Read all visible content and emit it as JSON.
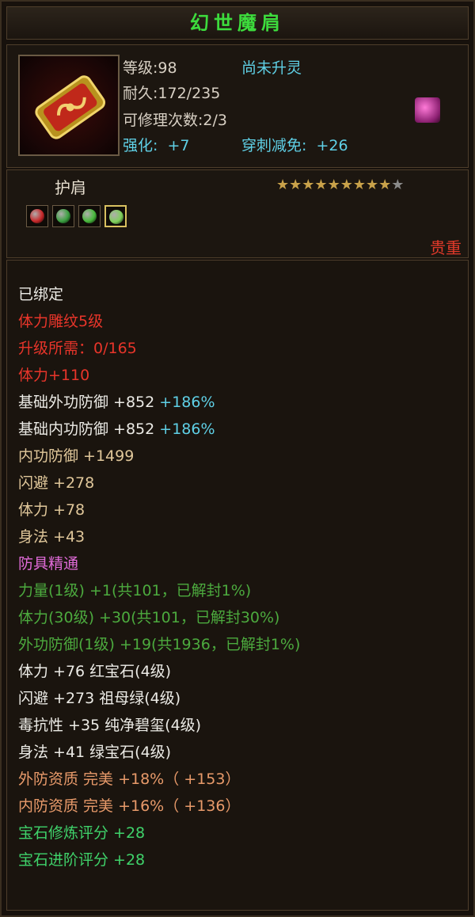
{
  "title": "幻世魔肩",
  "item": {
    "level_text": "等级:98",
    "spirit_status": "尚未升灵",
    "durability_text": "耐久:172/235",
    "repair_text": "可修理次数:2/3",
    "enhance_label": "强化:",
    "enhance_value": "+7",
    "pierce_label": "穿刺减免:",
    "pierce_value": "+26",
    "slot_type": "护肩",
    "stars_filled": 9,
    "stars_total": 10,
    "quality": "贵重",
    "gem_colors": [
      "#c8282a",
      "#3aa040",
      "#48b83c",
      "#7ed05a"
    ]
  },
  "colors": {
    "title": "#3ddc3d",
    "cyan": "#5fd0e6",
    "red": "#e8352a",
    "green": "#4caa3e",
    "bright_green": "#3fd26a",
    "orange": "#e89a6a",
    "pink": "#e06bd8",
    "tan": "#e0c79a"
  },
  "attributes": {
    "bound": "已绑定",
    "carving": "体力雕纹5级",
    "upgrade_need": "升级所需：0/165",
    "stamina_red": "体力+110",
    "base_outer_def": "基础外功防御 +852",
    "base_outer_def_pct": "+186%",
    "base_inner_def": "基础内功防御 +852",
    "base_inner_def_pct": "+186%",
    "inner_def": "内功防御 +1499",
    "dodge": "闪避 +278",
    "stamina": "体力 +78",
    "agility": "身法 +43",
    "mastery_title": "防具精通",
    "mastery_1": "力量(1级) +1(共101，已解封1%)",
    "mastery_2": "体力(30级) +30(共101，已解封30%)",
    "mastery_3": "外功防御(1级) +19(共1936，已解封1%)",
    "gem_1": "体力 +76 红宝石(4级)",
    "gem_2": "闪避 +273 祖母绿(4级)",
    "gem_3": "毒抗性 +35 纯净碧玺(4级)",
    "gem_4": "身法 +41 绿宝石(4级)",
    "quality_outer": "外防资质  完美 +18%（ +153）",
    "quality_inner": "内防资质  完美 +16%（ +136）",
    "gem_refine_score": "宝石修炼评分 +28",
    "gem_advance_score": "宝石进阶评分 +28"
  }
}
